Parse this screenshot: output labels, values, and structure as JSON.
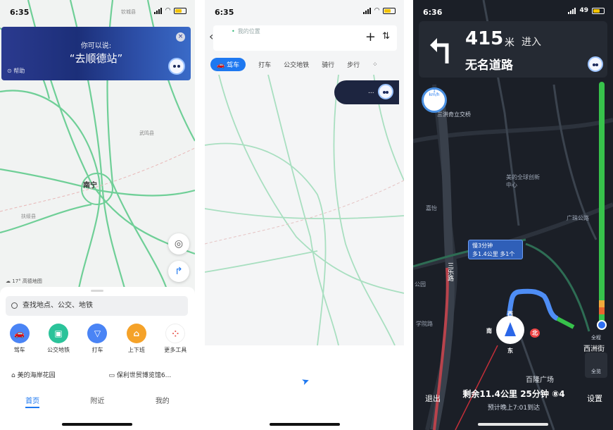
{
  "screen1": {
    "status": {
      "time": "6:35"
    },
    "assistant": {
      "hint": "你可以说:",
      "phrase": "“去顺德站”",
      "help": "帮助"
    },
    "map": {
      "city": "南宁",
      "weather": "17°",
      "attribution": "高德地图",
      "place_top": "钦城县",
      "place_mid": "武鸣县",
      "place_left": "扶绥县"
    },
    "search": {
      "placeholder": "查找地点、公交、地铁"
    },
    "quick_actions": [
      {
        "label": "驾车",
        "color": "#4a84f5",
        "icon": "car-icon"
      },
      {
        "label": "公交地铁",
        "color": "#2bc39a",
        "icon": "bus-icon"
      },
      {
        "label": "打车",
        "color": "#4a84f5",
        "icon": "taxi-icon"
      },
      {
        "label": "上下班",
        "color": "#f5a229",
        "icon": "commute-icon"
      },
      {
        "label": "更多工具",
        "color": "#e95a53",
        "icon": "grid-icon"
      }
    ],
    "recent": [
      "美的海岸花园",
      "保利世贸博览馆6..."
    ],
    "tabs": [
      "首页",
      "附近",
      "我的"
    ]
  },
  "screen2": {
    "status": {
      "time": "6:35"
    },
    "origin": "我的位置",
    "modes": [
      "驾车",
      "打车",
      "公交地铁",
      "骑行",
      "步行"
    ],
    "voice": "..."
  },
  "screen3": {
    "status": {
      "time": "6:36",
      "battery": "49"
    },
    "guide": {
      "distance": "415",
      "unit": "米",
      "action": "进入",
      "road": "无名道路"
    },
    "speed_limit": "1",
    "labels": {
      "bridge": "三洪奇立交桥",
      "road1": "广珠公路",
      "road2": "西洲街",
      "square": "百隆广场",
      "park": "公园",
      "school": "学院路",
      "mall": "美的全球创新中心",
      "road3": "三乐路",
      "junction": "嘉怡"
    },
    "callout": {
      "line1": "慢3分钟",
      "line2": "多1.4公里  多1个"
    },
    "compass": {
      "n": "北",
      "s": "南",
      "e": "东",
      "w": "西"
    },
    "side_buttons": [
      "全程",
      "全览"
    ],
    "bottom": {
      "exit": "退出",
      "remaining": "剩余11.4公里  25分钟  ⑧4",
      "eta": "预计晚上7:01到达",
      "settings": "设置"
    }
  }
}
